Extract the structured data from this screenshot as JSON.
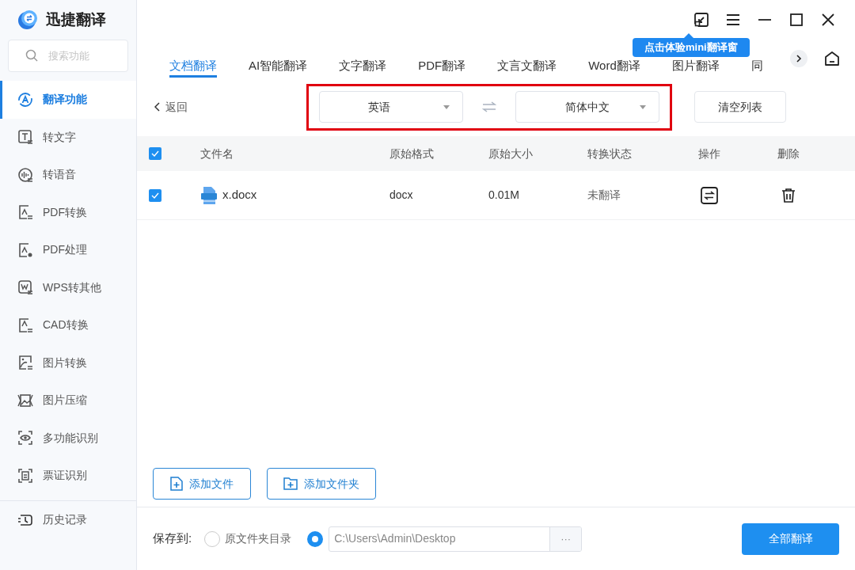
{
  "app": {
    "title": "迅捷翻译"
  },
  "search": {
    "placeholder": "搜索功能"
  },
  "sidebar": {
    "items": [
      {
        "label": "翻译功能",
        "selected": true
      },
      {
        "label": "转文字",
        "selected": false
      },
      {
        "label": "转语音",
        "selected": false
      },
      {
        "label": "PDF转换",
        "selected": false
      },
      {
        "label": "PDF处理",
        "selected": false
      },
      {
        "label": "WPS转其他",
        "selected": false
      },
      {
        "label": "CAD转换",
        "selected": false
      },
      {
        "label": "图片转换",
        "selected": false
      },
      {
        "label": "图片压缩",
        "selected": false
      },
      {
        "label": "多功能识别",
        "selected": false
      },
      {
        "label": "票证识别",
        "selected": false
      }
    ],
    "footer": "历史记录"
  },
  "tooltip": "点击体验mini翻译窗",
  "tabs": [
    {
      "label": "文档翻译",
      "selected": true
    },
    {
      "label": "AI智能翻译",
      "selected": false
    },
    {
      "label": "文字翻译",
      "selected": false
    },
    {
      "label": "PDF翻译",
      "selected": false
    },
    {
      "label": "文言文翻译",
      "selected": false
    },
    {
      "label": "Word翻译",
      "selected": false
    },
    {
      "label": "图片翻译",
      "selected": false
    },
    {
      "label": "同",
      "selected": false
    }
  ],
  "back": "返回",
  "source_language": "英语",
  "target_language": "简体中文",
  "clear_button": "清空列表",
  "table": {
    "all_checked": true,
    "columns": [
      "文件名",
      "原始格式",
      "原始大小",
      "转换状态",
      "操作",
      "删除"
    ],
    "rows": [
      {
        "checked": true,
        "name": "x.docx",
        "format": "docx",
        "size": "0.01M",
        "status": "未翻译"
      }
    ]
  },
  "add_file": "添加文件",
  "add_folder": "添加文件夹",
  "save": {
    "label": "保存到:",
    "options": [
      {
        "kind": "radio",
        "label": "原文件夹目录",
        "selected": false
      },
      {
        "kind": "path",
        "value": "C:\\Users\\Admin\\Desktop",
        "selected": true
      }
    ],
    "browse": "···"
  },
  "translate_all": "全部翻译"
}
